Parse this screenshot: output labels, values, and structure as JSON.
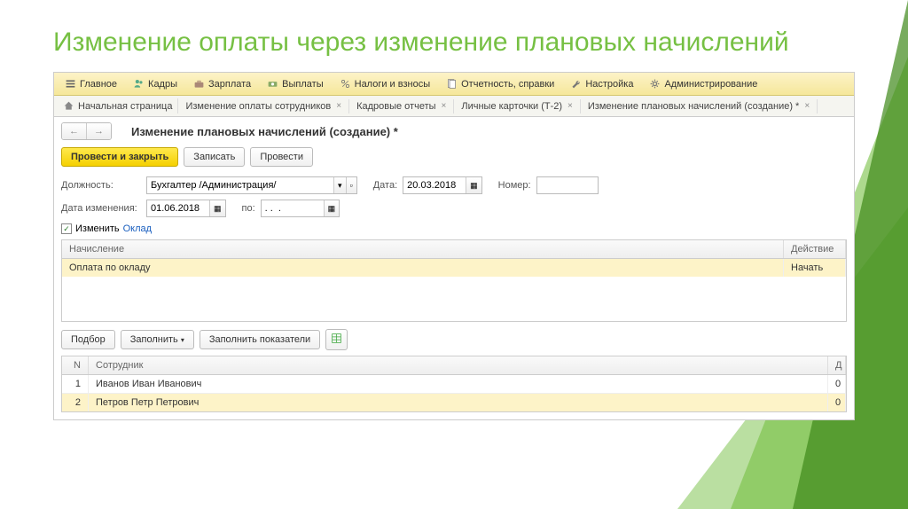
{
  "slide": {
    "title": "Изменение оплаты через изменение плановых начислений"
  },
  "topbar": [
    {
      "label": "Главное",
      "icon": "menu"
    },
    {
      "label": "Кадры",
      "icon": "people"
    },
    {
      "label": "Зарплата",
      "icon": "briefcase"
    },
    {
      "label": "Выплаты",
      "icon": "cash"
    },
    {
      "label": "Налоги и взносы",
      "icon": "percent"
    },
    {
      "label": "Отчетность, справки",
      "icon": "doc"
    },
    {
      "label": "Настройка",
      "icon": "wrench"
    },
    {
      "label": "Администрирование",
      "icon": "gear"
    }
  ],
  "tabs": [
    {
      "label": "Начальная страница",
      "home": true
    },
    {
      "label": "Изменение оплаты сотрудников"
    },
    {
      "label": "Кадровые отчеты"
    },
    {
      "label": "Личные карточки (Т-2)"
    },
    {
      "label": "Изменение плановых начислений (создание) *"
    }
  ],
  "page": {
    "title": "Изменение плановых начислений (создание) *"
  },
  "actions": {
    "primary": "Провести и закрыть",
    "save": "Записать",
    "post": "Провести"
  },
  "form": {
    "position_label": "Должность:",
    "position_value": "Бухгалтер /Администрация/",
    "date_label": "Дата:",
    "date_value": "20.03.2018",
    "number_label": "Номер:",
    "number_value": "",
    "change_date_label": "Дата изменения:",
    "change_date_value": "01.06.2018",
    "to_label": "по:",
    "to_value": ". .  .",
    "checkbox_label": "Изменить",
    "checkbox_link": "Оклад"
  },
  "accruals": {
    "col1": "Начисление",
    "col2": "Действие",
    "row": {
      "name": "Оплата по окладу",
      "action": "Начать"
    }
  },
  "lower_actions": {
    "podbor": "Подбор",
    "fill": "Заполнить",
    "fill_ind": "Заполнить показатели"
  },
  "employees": {
    "col_n": "N",
    "col_name": "Сотрудник",
    "col_d": "Д",
    "rows": [
      {
        "n": "1",
        "name": "Иванов Иван Иванович",
        "d": "0"
      },
      {
        "n": "2",
        "name": "Петров Петр Петрович",
        "d": "0"
      }
    ]
  }
}
